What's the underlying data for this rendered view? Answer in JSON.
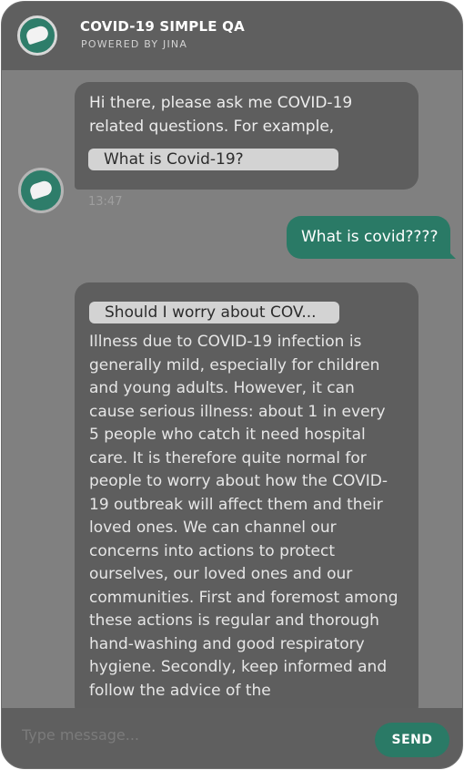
{
  "header": {
    "title": "COVID-19 SIMPLE QA",
    "subtitle": "POWERED BY JINA",
    "avatar_icon": "leaf-logo-icon"
  },
  "messages": [
    {
      "sender": "bot",
      "text": "Hi there, please ask me COVID-19 related questions. For example,",
      "suggestion": "What is Covid-19?",
      "time": "13:47"
    },
    {
      "sender": "user",
      "text": "What is covid????"
    },
    {
      "sender": "bot",
      "question": "Should I worry about COV...",
      "answer": "Illness due to COVID-19 infection is generally mild, especially for children and young adults. However, it can cause serious illness: about 1 in every 5 people who catch it need hospital care. It is therefore quite normal for people to worry about how the COVID-19 outbreak will affect them and their loved ones. We can channel our concerns into actions to protect ourselves, our loved ones and our communities. First and foremost among these actions is regular and thorough hand-washing and good respiratory hygiene. Secondly, keep informed and follow the advice of the"
    }
  ],
  "composer": {
    "placeholder": "Type message...",
    "value": "",
    "send_label": "SEND"
  },
  "colors": {
    "accent": "#2a7a66",
    "panel": "#808080",
    "header": "#5f5f5f",
    "bubble": "#5e5e5e"
  }
}
